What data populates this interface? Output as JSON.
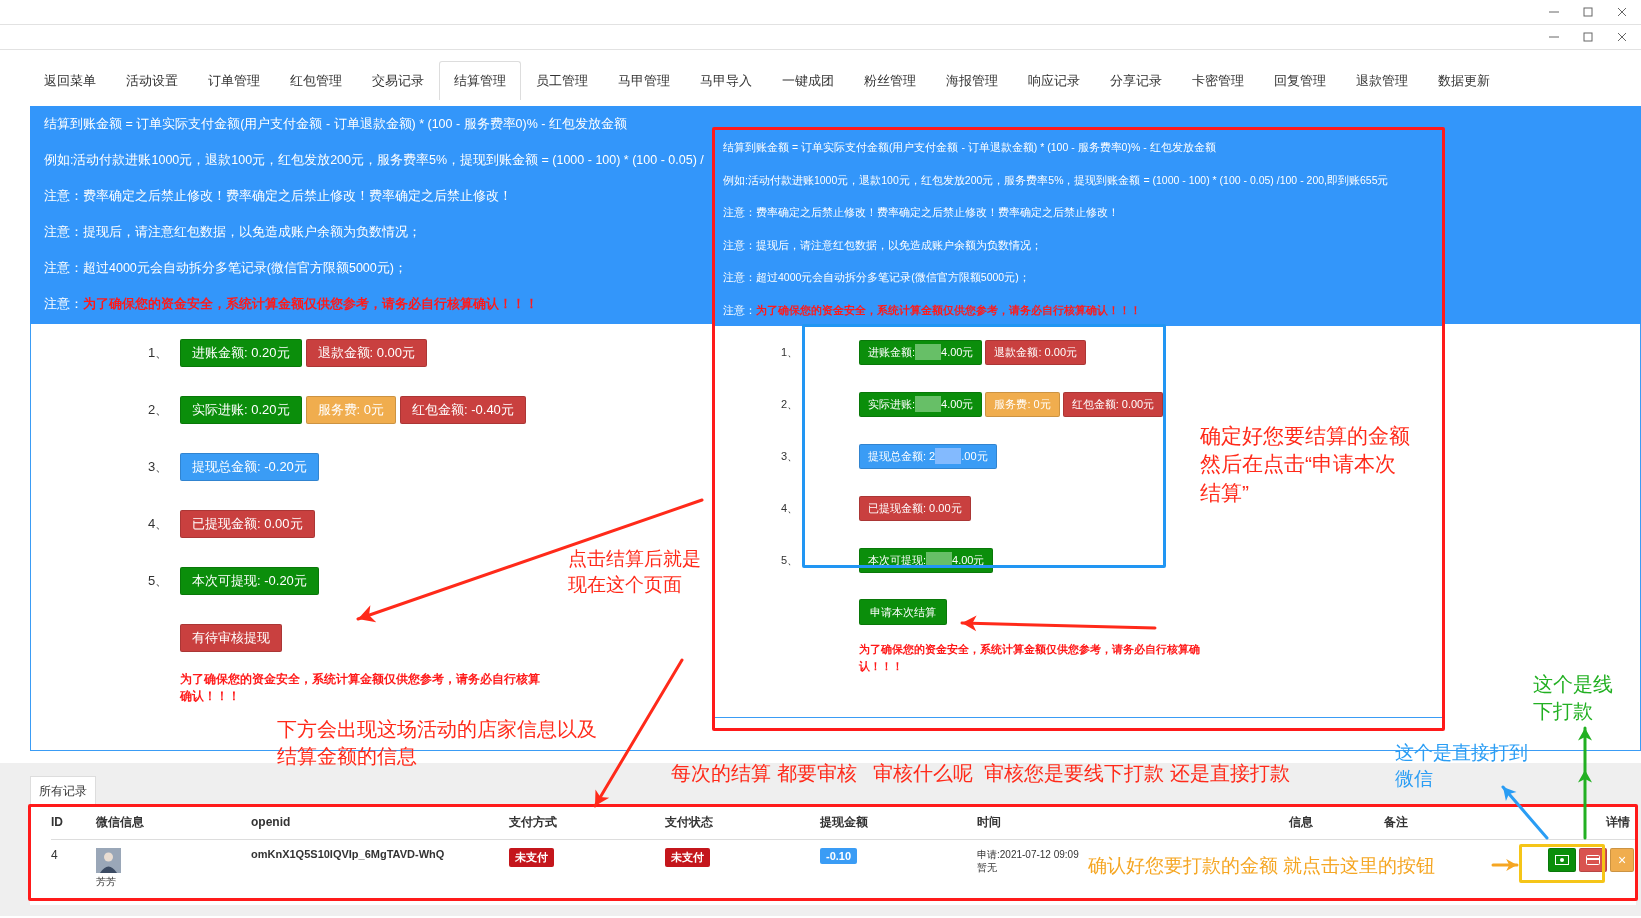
{
  "tabs": [
    {
      "label": "返回菜单",
      "selected": false
    },
    {
      "label": "活动设置",
      "selected": false
    },
    {
      "label": "订单管理",
      "selected": false
    },
    {
      "label": "红包管理",
      "selected": false
    },
    {
      "label": "交易记录",
      "selected": false
    },
    {
      "label": "结算管理",
      "selected": true
    },
    {
      "label": "员工管理",
      "selected": false
    },
    {
      "label": "马甲管理",
      "selected": false
    },
    {
      "label": "马甲导入",
      "selected": false
    },
    {
      "label": "一键成团",
      "selected": false
    },
    {
      "label": "粉丝管理",
      "selected": false
    },
    {
      "label": "海报管理",
      "selected": false
    },
    {
      "label": "响应记录",
      "selected": false
    },
    {
      "label": "分享记录",
      "selected": false
    },
    {
      "label": "卡密管理",
      "selected": false
    },
    {
      "label": "回复管理",
      "selected": false
    },
    {
      "label": "退款管理",
      "selected": false
    },
    {
      "label": "数据更新",
      "selected": false
    }
  ],
  "notice": {
    "lines": [
      {
        "kind": "plain",
        "text": "结算到账金额 = 订单实际支付金额(用户支付金额 - 订单退款金额) * (100 - 服务费率0)% - 红包发放金额"
      },
      {
        "kind": "plain",
        "text": "例如:活动付款进账1000元，退款100元，红包发放200元，服务费率5%，提现到账金额 = (1000 - 100) * (100 - 0.05) /"
      },
      {
        "kind": "plain",
        "text": "注意：费率确定之后禁止修改！费率确定之后禁止修改！费率确定之后禁止修改！"
      },
      {
        "kind": "plain",
        "text": "注意：提现后，请注意红包数据，以免造成账户余额为负数情况；"
      },
      {
        "kind": "plain",
        "text": "注意：超过4000元会自动拆分多笔记录(微信官方限额5000元)；"
      },
      {
        "kind": "warning",
        "label": "注意：",
        "text": "为了确保您的资金安全，系统计算金额仅供您参考，请务必自行核算确认！！！"
      }
    ]
  },
  "summary": {
    "rows": [
      {
        "number": "1、",
        "badges": [
          {
            "text": "进账金额: 0.20元",
            "color": "#0b8e0b"
          },
          {
            "text": "退款金额: 0.00元",
            "color": "#c9403f"
          }
        ]
      },
      {
        "number": "2、",
        "badges": [
          {
            "text": "实际进账: 0.20元",
            "color": "#0b8e0b"
          },
          {
            "text": "服务费: 0元",
            "color": "#f0ad4e"
          },
          {
            "text": "红包金额: -0.40元",
            "color": "#c9403f"
          }
        ]
      },
      {
        "number": "3、",
        "badges": [
          {
            "text": "提现总金额: -0.20元",
            "color": "#3a9cf5"
          }
        ]
      },
      {
        "number": "4、",
        "badges": [
          {
            "text": "已提现金额: 0.00元",
            "color": "#c9403f"
          }
        ]
      },
      {
        "number": "5、",
        "badges": [
          {
            "text": "本次可提现: -0.20元",
            "color": "#0b8e0b"
          }
        ]
      }
    ],
    "pending_button": "有待审核提现",
    "warning": "为了确保您的资金安全，系统计算金额仅供您参考，请务必自行核算确认！！！"
  },
  "records_tab": {
    "label": "所有记录",
    "selected": true
  },
  "table": {
    "columns": [
      "ID",
      "微信信息",
      "openid",
      "支付方式",
      "支付状态",
      "提现金额",
      "时间",
      "信息",
      "备注",
      "详情"
    ],
    "rows": [
      {
        "id": "4",
        "nickname": "芳芳",
        "openid": "omKnX1Q5S10IQVIp_6MgTAVD-WhQ",
        "pay_method": "未支付",
        "pay_status": "未支付",
        "amount": "-0.10",
        "time": "申请:2021-07-12 09:09",
        "time_note": "暂无",
        "actions": [
          {
            "kind": "pay"
          },
          {
            "kind": "card"
          },
          {
            "kind": "delete",
            "label": "×"
          }
        ]
      }
    ]
  },
  "inset": {
    "notice": {
      "lines": [
        {
          "kind": "plain",
          "text": "结算到账金额 = 订单实际支付金额(用户支付金额 - 订单退款金额) * (100 - 服务费率0)% - 红包发放金额"
        },
        {
          "kind": "plain",
          "text": "例如:活动付款进账1000元，退款100元，红包发放200元，服务费率5%，提现到账金额 = (1000 - 100) * (100 - 0.05) /100 - 200,即到账655元"
        },
        {
          "kind": "plain",
          "text": "注意：费率确定之后禁止修改！费率确定之后禁止修改！费率确定之后禁止修改！"
        },
        {
          "kind": "plain",
          "text": "注意：提现后，请注意红包数据，以免造成账户余额为负数情况；"
        },
        {
          "kind": "plain",
          "text": "注意：超过4000元会自动拆分多笔记录(微信官方限额5000元)；"
        },
        {
          "kind": "warning",
          "label": "注意：",
          "text": "为了确保您的资金安全，系统计算金额仅供您参考，请务必自行核算确认！！！"
        }
      ]
    },
    "rows": [
      {
        "number": "1、",
        "badges": [
          {
            "text": "进账金额:",
            "text_after": "4.00元",
            "redacted": true,
            "color": "#0b8e0b"
          },
          {
            "text": "退款金额: 0.00元",
            "redacted": false,
            "color": "#c9403f"
          }
        ]
      },
      {
        "number": "2、",
        "badges": [
          {
            "text": "实际进账:",
            "text_after": "4.00元",
            "redacted": true,
            "color": "#0b8e0b"
          },
          {
            "text": "服务费: 0元",
            "redacted": false,
            "color": "#f0ad4e"
          },
          {
            "text": "红包金额: 0.00元",
            "redacted": false,
            "color": "#c9403f"
          }
        ]
      },
      {
        "number": "3、",
        "badges": [
          {
            "text": "提现总金额: 2",
            "text_after": ".00元",
            "redacted": true,
            "color": "#3a9cf5"
          }
        ]
      },
      {
        "number": "4、",
        "badges": [
          {
            "text": "已提现金额: 0.00元",
            "redacted": false,
            "color": "#c9403f"
          }
        ]
      },
      {
        "number": "5、",
        "badges": [
          {
            "text": "本次可提现:",
            "text_after": "4.00元",
            "redacted": true,
            "color": "#0b8e0b"
          }
        ]
      }
    ],
    "submit_button": "申请本次结算",
    "warning": "为了确保您的资金安全，系统计算金额仅供您参考，请务必自行核算确认！！！"
  },
  "annotations": [
    {
      "lines": [
        "点击结算后就是",
        "现在这个页面"
      ],
      "color": "#ff2a1a"
    },
    {
      "lines": [
        "下方会出现这场活动的店家信息以及",
        "结算金额的信息"
      ],
      "color": "#ff2a1a"
    },
    {
      "lines": [
        "确定好您要结算的金额",
        "然后在点击“申请本次",
        "结算”"
      ],
      "color": "#ff2a1a"
    },
    {
      "lines": [
        "每次的结算 都要审核   审核什么呢  审核您是要线下打款 还是直接打款"
      ],
      "color": "#ff2a1a"
    },
    {
      "lines": [
        "这个是线",
        "下打款"
      ],
      "color": "#22b022"
    },
    {
      "lines": [
        "这个是直接打到",
        "微信"
      ],
      "color": "#2a9df4"
    },
    {
      "lines": [
        "确认好您要打款的金额 就点击这里的按钮"
      ],
      "color": "#f5a623"
    }
  ]
}
